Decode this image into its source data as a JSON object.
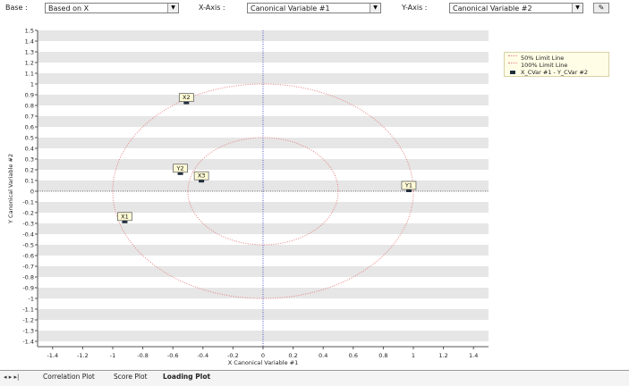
{
  "toolbar": {
    "base_label": "Base :",
    "base_value": "Based on X",
    "xaxis_label": "X-Axis :",
    "xaxis_value": "Canonical Variable #1",
    "yaxis_label": "Y-Axis :",
    "yaxis_value": "Canonical Variable #2",
    "tool_icon": "eraser-icon"
  },
  "legend": {
    "items": [
      {
        "label": "50% Limit Line",
        "color": "#e88080",
        "style": "dotted"
      },
      {
        "label": "100% Limit Line",
        "color": "#e88080",
        "style": "dotted"
      },
      {
        "label": "X_CVar #1 - Y_CVar #2",
        "color": "#1f2d3d",
        "style": "marker"
      }
    ]
  },
  "chart_data": {
    "type": "scatter",
    "xlabel": "X Canonical Variable #1",
    "ylabel": "Y Canonical Variable #2",
    "xlim": [
      -1.5,
      1.5
    ],
    "ylim": [
      -1.45,
      1.5
    ],
    "x_ticks": [
      "-1.4",
      "-1.2",
      "-1",
      "-0.8",
      "-0.6",
      "-0.4",
      "-0.2",
      "0",
      "0.2",
      "0.4",
      "0.6",
      "0.8",
      "1",
      "1.2",
      "1.4"
    ],
    "x_tick_values": [
      -1.4,
      -1.2,
      -1.0,
      -0.8,
      -0.6,
      -0.4,
      -0.2,
      0,
      0.2,
      0.4,
      0.6,
      0.8,
      1.0,
      1.2,
      1.4
    ],
    "y_ticks": [
      "1.5",
      "1.4",
      "1.3",
      "1.2",
      "1.1",
      "1",
      "0.9",
      "0.8",
      "0.7",
      "0.6",
      "0.5",
      "0.4",
      "0.3",
      "0.2",
      "0.1",
      "0",
      "-0.1",
      "-0.2",
      "-0.3",
      "-0.4",
      "-0.5",
      "-0.6",
      "-0.7",
      "-0.8",
      "-0.9",
      "-1",
      "-1.1",
      "-1.2",
      "-1.3",
      "-1.4"
    ],
    "y_tick_values": [
      1.5,
      1.4,
      1.3,
      1.2,
      1.1,
      1.0,
      0.9,
      0.8,
      0.7,
      0.6,
      0.5,
      0.4,
      0.3,
      0.2,
      0.1,
      0,
      -0.1,
      -0.2,
      -0.3,
      -0.4,
      -0.5,
      -0.6,
      -0.7,
      -0.8,
      -0.9,
      -1.0,
      -1.1,
      -1.2,
      -1.3,
      -1.4
    ],
    "limit_circles": [
      0.5,
      1.0
    ],
    "points": [
      {
        "label": "X2",
        "x": -0.51,
        "y": 0.82
      },
      {
        "label": "Y2",
        "x": -0.55,
        "y": 0.16
      },
      {
        "label": "X3",
        "x": -0.41,
        "y": 0.09
      },
      {
        "label": "X1",
        "x": -0.92,
        "y": -0.29
      },
      {
        "label": "Y1",
        "x": 0.97,
        "y": 0.0
      }
    ],
    "grid": true,
    "legend_position": "top-right"
  },
  "tabs": {
    "nav_icons": [
      "first-icon",
      "prev-icon",
      "next-icon",
      "last-icon"
    ],
    "nav_glyphs": "◂ ▸ ▸|",
    "items": [
      "Correlation Plot",
      "Score Plot",
      "Loading Plot"
    ],
    "active": "Loading Plot"
  }
}
